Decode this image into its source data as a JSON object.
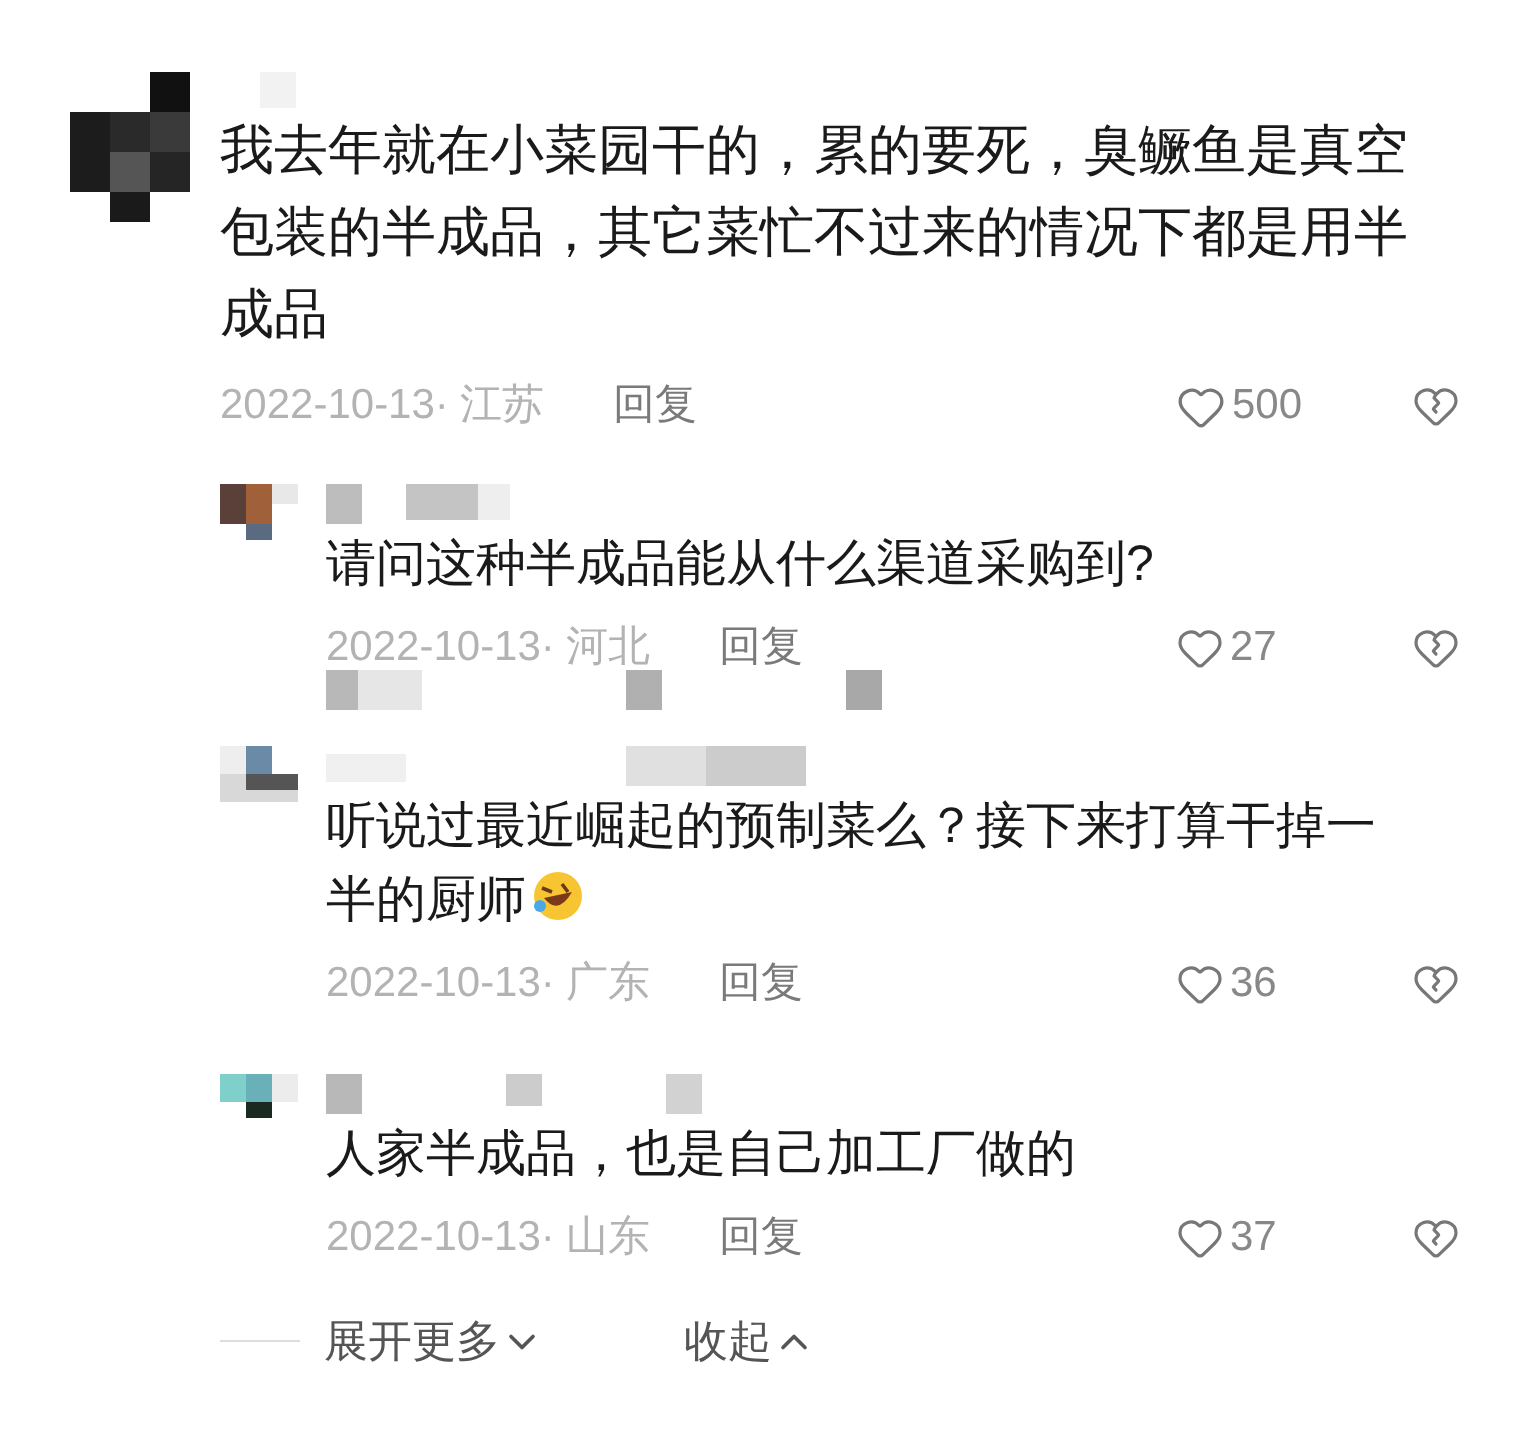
{
  "comment": {
    "text": "我去年就在小菜园干的，累的要死，臭鳜鱼是真空包装的半成品，其它菜忙不过来的情况下都是用半成品",
    "date": "2022-10-13· 江苏",
    "reply_label": "回复",
    "likes": "500"
  },
  "replies": [
    {
      "text": "请问这种半成品能从什么渠道采购到?",
      "date": "2022-10-13· 河北",
      "reply_label": "回复",
      "likes": "27",
      "emoji": false
    },
    {
      "text": "听说过最近崛起的预制菜么？接下来打算干掉一半的厨师",
      "date": "2022-10-13· 广东",
      "reply_label": "回复",
      "likes": "36",
      "emoji": true
    },
    {
      "text": "人家半成品，也是自己加工厂做的",
      "date": "2022-10-13· 山东",
      "reply_label": "回复",
      "likes": "37",
      "emoji": false
    }
  ],
  "footer": {
    "expand": "展开更多",
    "collapse": "收起"
  }
}
